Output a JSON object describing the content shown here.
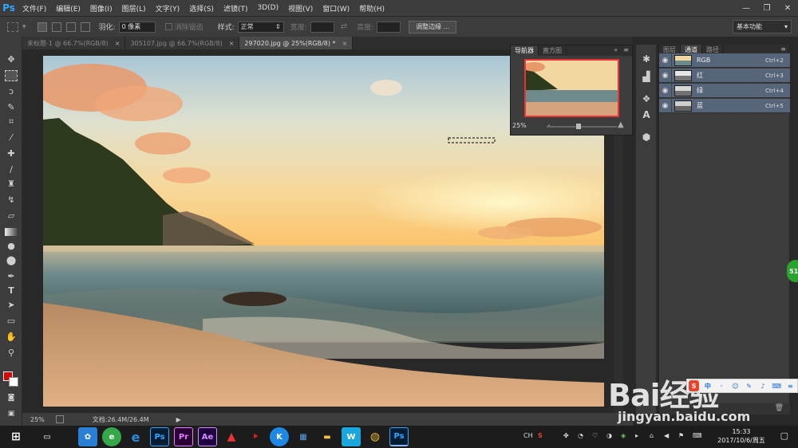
{
  "app": {
    "logo": "Ps"
  },
  "menu": [
    "文件(F)",
    "编辑(E)",
    "图像(I)",
    "图层(L)",
    "文字(Y)",
    "选择(S)",
    "滤镜(T)",
    "3D(D)",
    "视图(V)",
    "窗口(W)",
    "帮助(H)"
  ],
  "window_controls": {
    "minimize": "—",
    "restore": "❐",
    "close": "✕"
  },
  "options": {
    "feather_label": "羽化:",
    "feather_value": "0 像素",
    "antialias_label": "消除锯齿",
    "style_label": "样式:",
    "style_value": "正常",
    "width_label": "宽度:",
    "height_label": "高度:",
    "refine_button": "调整边缘 ...",
    "workspace": "基本功能"
  },
  "tabs": [
    {
      "label": "未标题-1 @ 66.7%(RGB/8)"
    },
    {
      "label": "305107.jpg @ 66.7%(RGB/8)"
    },
    {
      "label": "297020.jpg @ 25%(RGB/8) *"
    }
  ],
  "status": {
    "zoom": "25%",
    "doc_info": "文档:26.4M/26.4M"
  },
  "navigator": {
    "tabs": [
      "导航器",
      "直方图"
    ],
    "zoom": "25%"
  },
  "channels": {
    "tabs": [
      "图层",
      "通道",
      "路径"
    ],
    "items": [
      {
        "name": "RGB",
        "shortcut": "Ctrl+2"
      },
      {
        "name": "红",
        "shortcut": "Ctrl+3"
      },
      {
        "name": "绿",
        "shortcut": "Ctrl+4"
      },
      {
        "name": "蓝",
        "shortcut": "Ctrl+5"
      }
    ]
  },
  "side_badge": "51",
  "watermark": {
    "brand": "Bai经验",
    "url": "jingyan.baidu.com"
  },
  "taskbar": {
    "ime": "CH",
    "time": "15:33",
    "date": "2017/10/6/周五"
  }
}
